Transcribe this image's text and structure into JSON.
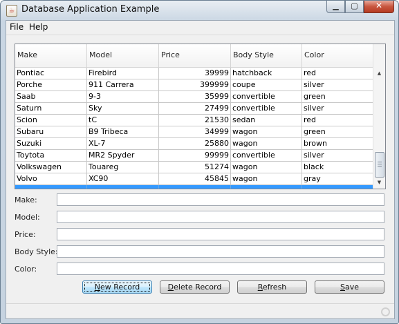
{
  "window": {
    "title": "Database Application Example"
  },
  "menubar": {
    "items": [
      "File",
      "Help"
    ]
  },
  "table": {
    "columns": [
      "Make",
      "Model",
      "Price",
      "Body Style",
      "Color"
    ],
    "rows": [
      [
        "Pontiac",
        "Firebird",
        "39999",
        "hatchback",
        "red"
      ],
      [
        "Porche",
        "911 Carrera",
        "399999",
        "coupe",
        "silver"
      ],
      [
        "Saab",
        "9-3",
        "35999",
        "convertible",
        "green"
      ],
      [
        "Saturn",
        "Sky",
        "27499",
        "convertible",
        "silver"
      ],
      [
        "Scion",
        "tC",
        "21530",
        "sedan",
        "red"
      ],
      [
        "Subaru",
        "B9 Tribeca",
        "34999",
        "wagon",
        "green"
      ],
      [
        "Suzuki",
        "XL-7",
        "25880",
        "wagon",
        "brown"
      ],
      [
        "Toytota",
        "MR2 Spyder",
        "99999",
        "convertible",
        "silver"
      ],
      [
        "Volkswagen",
        "Touareg",
        "51274",
        "wagon",
        "black"
      ],
      [
        "Volvo",
        "XC90",
        "45845",
        "wagon",
        "gray"
      ],
      [
        "",
        "",
        "",
        "",
        ""
      ]
    ],
    "selected_row": 10
  },
  "form": {
    "make_label": "Make:",
    "model_label": "Model:",
    "price_label": "Price:",
    "body_style_label": "Body Style:",
    "color_label": "Color:",
    "make_value": "",
    "model_value": "",
    "price_value": "",
    "body_style_value": "",
    "color_value": ""
  },
  "buttons": {
    "new_record": {
      "mnemonic": "N",
      "rest": "ew Record"
    },
    "delete_record": {
      "mnemonic": "D",
      "rest": "elete Record"
    },
    "refresh": {
      "mnemonic": "R",
      "rest": "efresh"
    },
    "save": {
      "mnemonic": "S",
      "rest": "ave"
    }
  },
  "colors": {
    "selection": "#3399ff",
    "title_gradient_top": "#e9eef3",
    "close_button": "#c8563f"
  },
  "icons": [
    "java-app-icon",
    "minimize-icon",
    "maximize-icon",
    "close-icon",
    "scroll-up-arrow-icon",
    "scroll-down-arrow-icon",
    "resize-grip-icon"
  ]
}
